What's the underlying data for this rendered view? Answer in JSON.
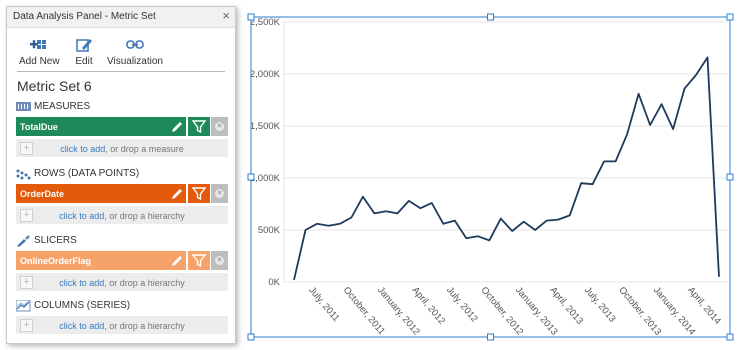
{
  "panel": {
    "title": "Data Analysis Panel - Metric Set",
    "close_glyph": "×",
    "toolbar": {
      "add_new": "Add New",
      "edit": "Edit",
      "visualization": "Visualization"
    },
    "metric_set_title": "Metric Set 6",
    "sections": [
      {
        "heading": "MEASURES",
        "icon": "measures-icon",
        "chip": {
          "label": "TotalDue",
          "color": "#1e8a5a",
          "filter_color": "#1e8a5a"
        },
        "drop": {
          "link": "click to add",
          "rest": ", or drop a measure"
        }
      },
      {
        "heading": "ROWS (DATA POINTS)",
        "icon": "rows-icon",
        "chip": {
          "label": "OrderDate",
          "color": "#e35a0b",
          "filter_color": "#e35a0b"
        },
        "drop": {
          "link": "click to add",
          "rest": ", or drop a hierarchy"
        }
      },
      {
        "heading": "SLICERS",
        "icon": "slicers-icon",
        "chip": {
          "label": "OnlineOrderFlag",
          "color": "#f6a36b",
          "filter_color": "#f6a36b"
        },
        "drop": {
          "link": "click to add",
          "rest": ", or drop a hierarchy"
        }
      },
      {
        "heading": "COLUMNS (SERIES)",
        "icon": "columns-icon",
        "chip": null,
        "drop": {
          "link": "click to add",
          "rest": ", or drop a hierarchy"
        }
      }
    ]
  },
  "chart_data": {
    "type": "line",
    "title": "",
    "xlabel": "",
    "ylabel": "",
    "ylim": [
      0,
      2500000
    ],
    "y_ticks": [
      "0K",
      "500K",
      "1,000K",
      "1,500K",
      "2,000K",
      "2,500K"
    ],
    "x_tick_labels": [
      {
        "label": "July, 2011",
        "index": 1
      },
      {
        "label": "October, 2011",
        "index": 4
      },
      {
        "label": "January, 2012",
        "index": 7
      },
      {
        "label": "April, 2012",
        "index": 10
      },
      {
        "label": "July, 2012",
        "index": 13
      },
      {
        "label": "October, 2012",
        "index": 16
      },
      {
        "label": "January, 2013",
        "index": 19
      },
      {
        "label": "April, 2013",
        "index": 22
      },
      {
        "label": "July, 2013",
        "index": 25
      },
      {
        "label": "October, 2013",
        "index": 28
      },
      {
        "label": "January, 2014",
        "index": 31
      },
      {
        "label": "April, 2014",
        "index": 34
      }
    ],
    "series": [
      {
        "color": "#1f3a5c",
        "x": [
          "2011-06",
          "2011-07",
          "2011-08",
          "2011-09",
          "2011-10",
          "2011-11",
          "2011-12",
          "2012-01",
          "2012-02",
          "2012-03",
          "2012-04",
          "2012-05",
          "2012-06",
          "2012-07",
          "2012-08",
          "2012-09",
          "2012-10",
          "2012-11",
          "2012-12",
          "2013-01",
          "2013-02",
          "2013-03",
          "2013-04",
          "2013-05",
          "2013-06",
          "2013-07",
          "2013-08",
          "2013-09",
          "2013-10",
          "2013-11",
          "2013-12",
          "2014-01",
          "2014-02",
          "2014-03",
          "2014-04",
          "2014-05",
          "2014-06",
          "2014-07"
        ],
        "values": [
          20000,
          500000,
          560000,
          540000,
          560000,
          620000,
          820000,
          660000,
          680000,
          660000,
          780000,
          710000,
          760000,
          560000,
          590000,
          420000,
          440000,
          400000,
          610000,
          490000,
          580000,
          500000,
          590000,
          600000,
          640000,
          950000,
          940000,
          1160000,
          1160000,
          1420000,
          1810000,
          1510000,
          1710000,
          1470000,
          1860000,
          1990000,
          2160000,
          50000
        ]
      }
    ],
    "grid": true,
    "legend": "none"
  }
}
